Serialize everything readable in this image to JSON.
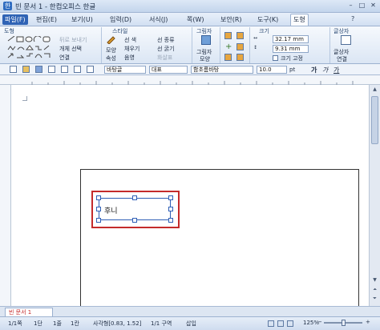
{
  "window": {
    "title": "빈 문서 1 - 한컴오피스 한글",
    "min": "–",
    "max": "□",
    "close": "✕"
  },
  "menu": [
    {
      "id": "m-file",
      "label": "파일(F)"
    },
    {
      "id": "m-edit",
      "label": "편집(E)"
    },
    {
      "id": "m-view",
      "label": "보기(U)"
    },
    {
      "id": "m-insert",
      "label": "입력(D)"
    },
    {
      "id": "m-format",
      "label": "서식(J)"
    },
    {
      "id": "m-page",
      "label": "쪽(W)"
    },
    {
      "id": "m-security",
      "label": "보안(R)"
    },
    {
      "id": "m-tools",
      "label": "도구(K)"
    },
    {
      "id": "m-shape",
      "label": "도형"
    }
  ],
  "ribbon": {
    "shape_group": "도형",
    "arrange_back": "뒤로 보내기",
    "group_select": "개체 선택",
    "connector": "연결",
    "style_group": "스타일",
    "shape_style_label": "모양",
    "shape_style_label2": "속성",
    "line_color": "선 색",
    "fill": "채우기",
    "shadow": "음영",
    "line_type": "선 종류",
    "line_thick": "선 굵기",
    "arrow_style": "화살표",
    "picture_group": "그림자",
    "picture_label": "그림자",
    "picture_label2": "모양",
    "size_group": "크기",
    "width_value": "32.17 mm",
    "height_value": "9.31 mm",
    "fix_size": "크기 고정",
    "textbox_group": "글상자",
    "textbox_label": "글상자",
    "textbox_label2": "연결"
  },
  "toolbar2": {
    "style": "바탕글",
    "lang": "대표",
    "font": "함초롬바탕",
    "size": "10.0",
    "unit": "pt",
    "bold": "가",
    "italic": "가",
    "underline": "가"
  },
  "document": {
    "textbox_text": "후니"
  },
  "tabs": {
    "doc_tab": "빈 문서 1"
  },
  "status": {
    "page": "1/1쪽",
    "column": "1단",
    "line": "1줄",
    "col": "1칸",
    "object": "사각형[0.83, 1.52]",
    "section": "1/1 구역",
    "mode": "삽입",
    "zoom": "125%"
  },
  "colors": {
    "accent": "#2f63b5",
    "highlight_box": "#c42b2b",
    "handle": "#2f5fb6"
  }
}
